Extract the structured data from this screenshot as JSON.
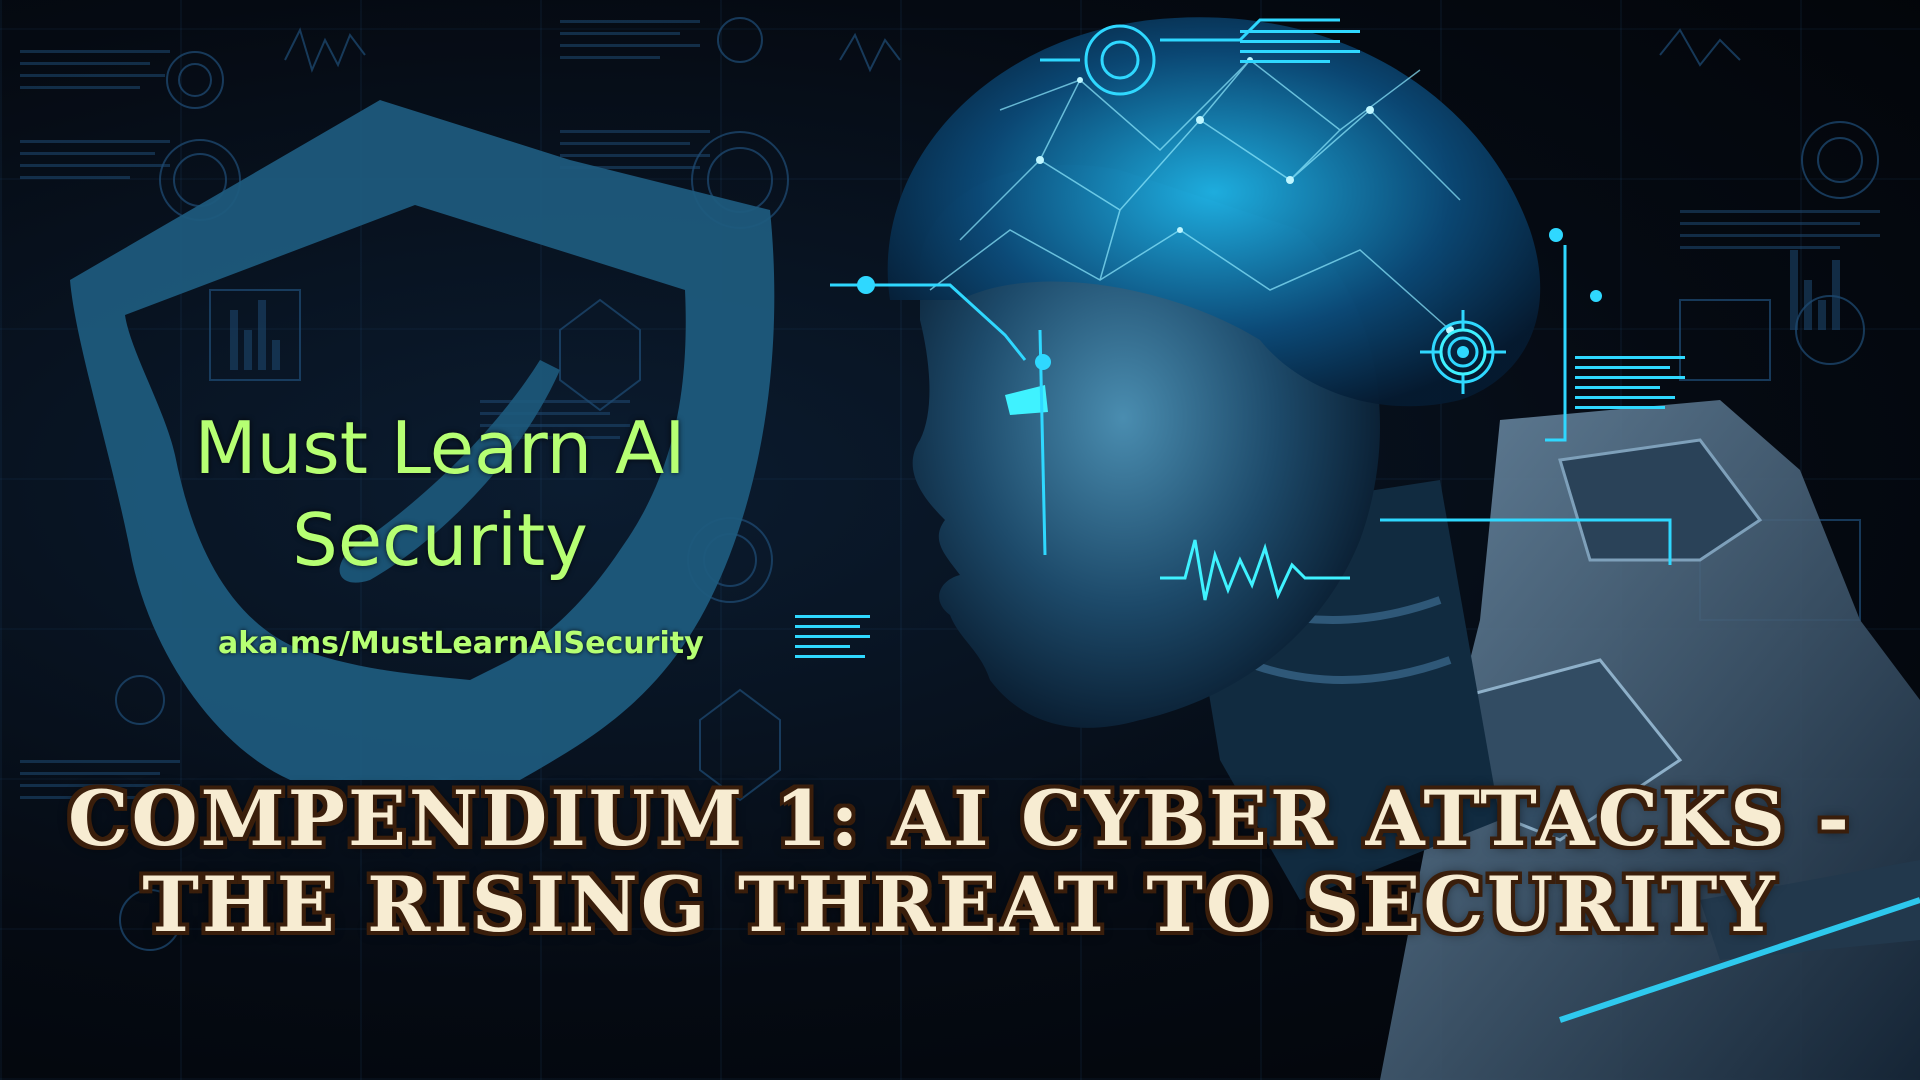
{
  "brand": {
    "title": "Must Learn AI Security",
    "url": "aka.ms/MustLearnAISecurity"
  },
  "headline": "COMPENDIUM 1: AI CYBER ATTACKS - THE RISING THREAT TO SECURITY",
  "colors": {
    "background": "#04070d",
    "shield": "#1d5a7c",
    "brand_text": "#b6ff73",
    "headline_text": "#f7ecd2",
    "headline_outline": "#3a1e0b",
    "hud_glow": "#2fd8ff"
  },
  "icons": [
    "shield-icon",
    "robot-head-illustration",
    "target-crosshair-icon",
    "heartbeat-waveform-icon"
  ]
}
